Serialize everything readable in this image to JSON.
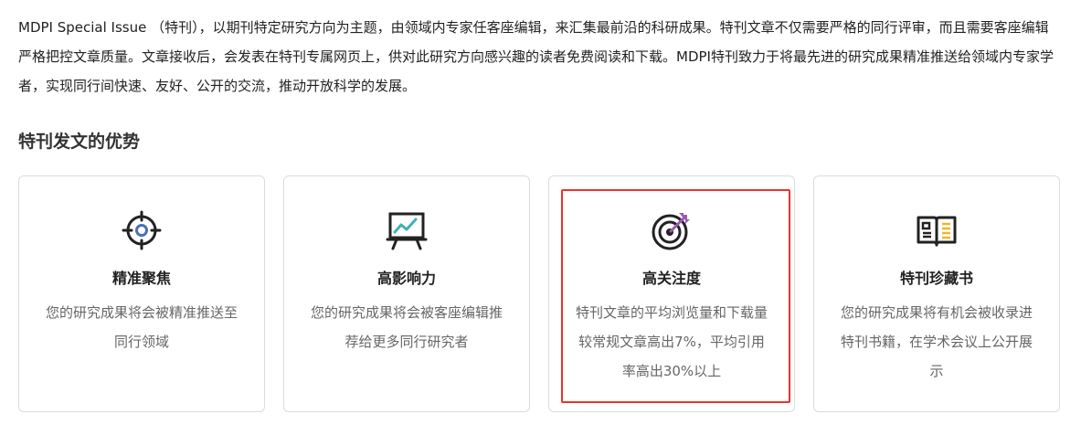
{
  "intro": {
    "text": "MDPI Special Issue （特刊），以期刊特定研究方向为主题，由领域内专家任客座编辑，来汇集最前沿的科研成果。特刊文章不仅需要严格的同行评审，而且需要客座编辑严格把控文章质量。文章接收后，会发表在特刊专属网页上，供对此研究方向感兴趣的读者免费阅读和下载。MDPI特刊致力于将最先进的研究成果精准推送给领域内专家学者，实现同行间快速、友好、公开的交流，推动开放科学的发展。"
  },
  "section": {
    "title": "特刊发文的优势"
  },
  "cards": [
    {
      "title": "精准聚焦",
      "desc": "您的研究成果将会被精准推送至同行领域",
      "icon": "crosshair-icon"
    },
    {
      "title": "高影响力",
      "desc": "您的研究成果将会被客座编辑推荐给更多同行研究者",
      "icon": "presentation-chart-icon"
    },
    {
      "title": "高关注度",
      "desc": "特刊文章的平均浏览量和下载量较常规文章高出7%，平均引用率高出30%以上",
      "icon": "target-arrow-icon"
    },
    {
      "title": "特刊珍藏书",
      "desc": "您的研究成果将有机会被收录进特刊书籍，在学术会议上公开展示",
      "icon": "open-book-icon"
    }
  ],
  "colors": {
    "accent_blue": "#4a6fbf",
    "accent_teal": "#3bb3b0",
    "accent_purple": "#9b59b6",
    "accent_yellow": "#f0b429",
    "highlight_red": "#e8342b"
  }
}
